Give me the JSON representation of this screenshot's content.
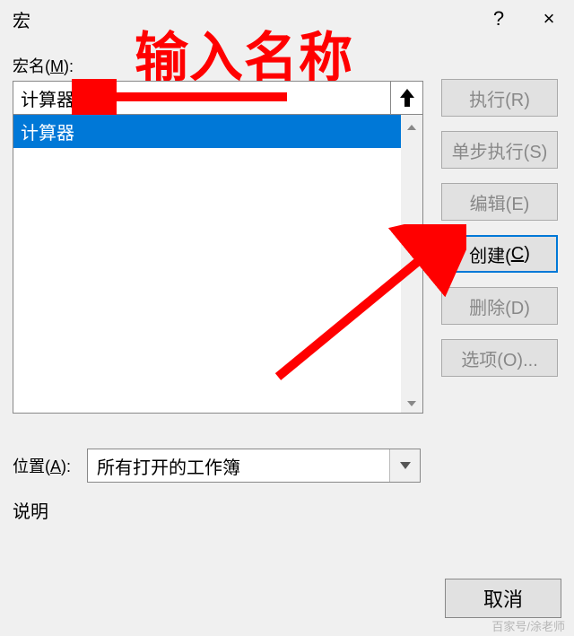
{
  "title": "宏",
  "help_symbol": "?",
  "close_symbol": "×",
  "annotation": "输入名称",
  "macro_name_label_pre": "宏名(",
  "macro_name_label_u": "M",
  "macro_name_label_post": "):",
  "macro_name_value": "计算器2",
  "list": {
    "items": [
      "计算器"
    ]
  },
  "buttons": {
    "run": "执行(R)",
    "step": "单步执行(S)",
    "edit": "编辑(E)",
    "create_pre": "创建(",
    "create_u": "C",
    "create_post": ")",
    "delete": "删除(D)",
    "options": "选项(O)..."
  },
  "location_label_pre": "位置(",
  "location_label_u": "A",
  "location_label_post": "):",
  "location_value": "所有打开的工作簿",
  "description_label": "说明",
  "cancel": "取消",
  "watermark": "百家号/涂老师"
}
